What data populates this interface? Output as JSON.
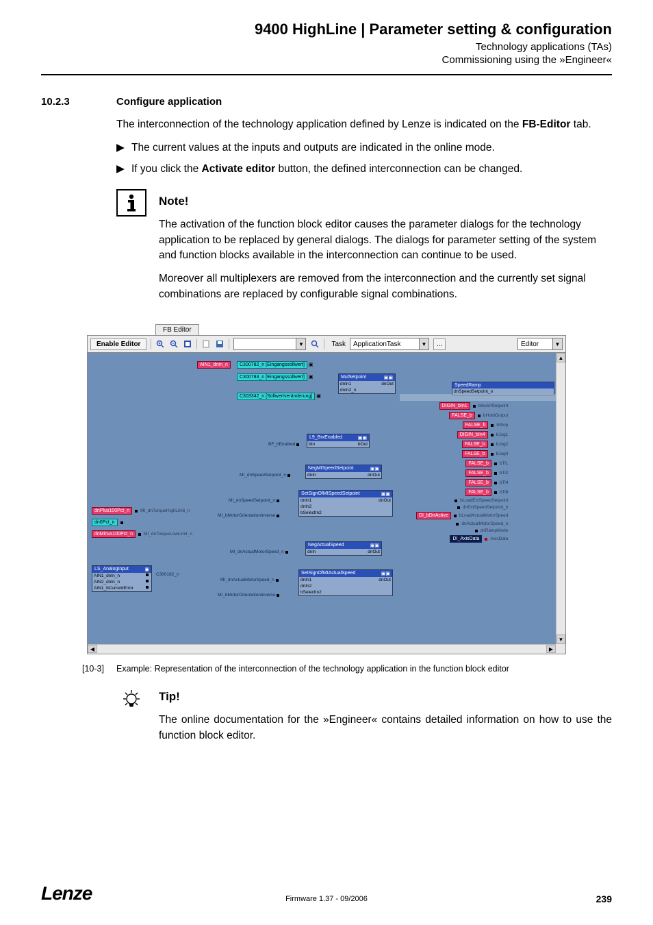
{
  "header": {
    "title": "9400 HighLine | Parameter setting & configuration",
    "sub1": "Technology applications (TAs)",
    "sub2": "Commissioning using the »Engineer«"
  },
  "section": {
    "num": "10.2.3",
    "title": "Configure application"
  },
  "intro": {
    "p1a": "The interconnection of the technology application defined by Lenze is indicated on the ",
    "p1b": "FB-Editor",
    "p1c": " tab.",
    "b1": "The current values at the inputs and outputs are indicated in the online mode.",
    "b2a": "If you click the ",
    "b2b": "Activate editor",
    "b2c": " button, the defined interconnection can be changed."
  },
  "note": {
    "label": "Note!",
    "p1": "The activation of the function block editor causes the parameter dialogs for the technology application to be replaced by general dialogs. The dialogs for parameter setting of the system and function blocks available in the interconnection can continue to be used.",
    "p2": "Moreover all multiplexers are removed from the interconnection and the currently set signal combinations are replaced by configurable signal combinations."
  },
  "fbEditor": {
    "tab": "FB Editor",
    "enable": "Enable Editor",
    "taskLabel": "Task",
    "taskValue": "ApplicationTask",
    "editorLabel": "Editor",
    "dots": "...",
    "searchPlaceholder": ""
  },
  "canvas": {
    "paramBlocks": {
      "a": "C300782_n [Eingangssollwert]",
      "b": "C300783_n [Eingangssollwert]",
      "c": "C303342_n [Sollwertveränderung]"
    },
    "mulSetpoint": {
      "title": "MulSetpoint",
      "in1": "dnIn1",
      "in2": "dnIn2_n",
      "out": "dnOut"
    },
    "brEnabled": {
      "title": "L9_BrxEnabled",
      "in": "bIn",
      "out": "bOut",
      "pin": "BF_bEnabled"
    },
    "negSpeed": {
      "title": "NegMISpeedSetpoint",
      "in": "dnIn",
      "out": "dnOut",
      "pin": "MI_dnSpeedSetpoint_n"
    },
    "setSignSpeed": {
      "title": "SetSignOfMISpeedSetpoint",
      "in1": "dnIn1",
      "in2": "dnIn2",
      "sel": "bSelectIn2",
      "out": "dnOut",
      "pin1": "MI_dnSpeedSetpoint_n",
      "pin2": "MI_bMotorOrientationInverse"
    },
    "negActual": {
      "title": "NegActualSpeed",
      "in": "dnIn",
      "out": "dnOut",
      "pin": "MI_dnActualMotorSpeed_n"
    },
    "setSignActual": {
      "title": "SetSignOfMIActualSpeed",
      "in1": "dnIn1",
      "in2": "dnIn2",
      "sel": "bSelectIn2",
      "out": "dnOut",
      "pin1": "MI_dnActualMotorSpeed_n",
      "pin2": "MI_bMotorOrientationInverse"
    },
    "leftPorts": {
      "ain1": "AIN1_dnIn_n",
      "p100": "dnPlus100Pct_n",
      "zero": "dn0Pct_n",
      "m100": "dnMinus100Pct_n",
      "torqHigh": "MI_dnTorqueHighLimit_n",
      "torqLow": "MI_dnTorqueLowLimit_n"
    },
    "analogInput": {
      "title": "LS_AnalogInput",
      "p1": "AIN1_dnIn_n",
      "p2": "AIN2_dnIn_n",
      "p3": "AIN1_bCurrentError",
      "code": "C300182_n"
    },
    "speedRamp": {
      "title": "SpeedRamp",
      "p01": "dnSpeedSetpoint_n",
      "p02": "bInvertSetpoint",
      "p03": "bHoldOutput",
      "p04": "bStop",
      "p05": "bJog1",
      "p06": "bJog2",
      "p07": "bJog4",
      "p08": "bTi1",
      "p09": "bTi2",
      "p10": "bTi4",
      "p11": "bTi8",
      "p12": "bLoadExtSpeedSetpoint",
      "p13": "dnExtSpeedSetpoint_n",
      "p14": "bLoadActualMotorSpeed",
      "p15": "dnActualMotorSpeed_n",
      "p16": "dnRampMode",
      "p17": "AxisData"
    },
    "bools": {
      "digin1": "DIGIN_bIn1",
      "digin4": "DIGIN_bIn4",
      "false": "FALSE_b",
      "diActive": "DI_bDirActive",
      "axis": "DI_AxisData"
    }
  },
  "caption": {
    "num": "[10-3]",
    "text": "Example: Representation of the interconnection of the technology application in the function block editor"
  },
  "tip": {
    "label": "Tip!",
    "text": "The online documentation for the »Engineer« contains detailed information on how to use the function block editor."
  },
  "footer": {
    "brand": "Lenze",
    "center": "Firmware 1.37 - 09/2006",
    "page": "239"
  }
}
